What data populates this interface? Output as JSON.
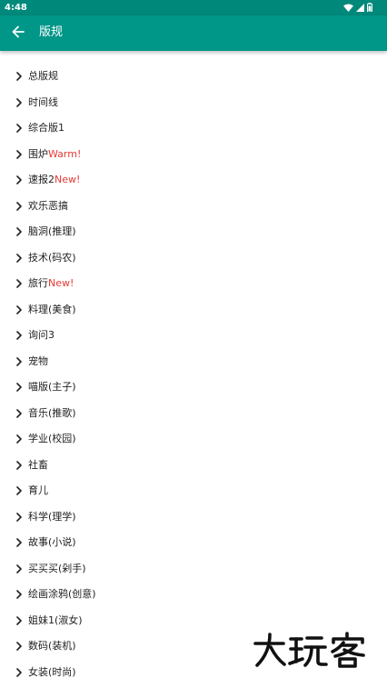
{
  "status_bar": {
    "time": "4:48",
    "icons": [
      "wifi-icon",
      "signal-icon",
      "battery-icon"
    ]
  },
  "app_bar": {
    "title": "版规",
    "back_icon": "arrow-left-icon",
    "background": "#009688"
  },
  "forums": [
    {
      "label": "总版规",
      "badge": ""
    },
    {
      "label": "时间线",
      "badge": ""
    },
    {
      "label": "综合版1",
      "badge": ""
    },
    {
      "label": "围炉",
      "badge": "Warm!"
    },
    {
      "label": "速报2",
      "badge": "New!"
    },
    {
      "label": "欢乐恶搞",
      "badge": ""
    },
    {
      "label": "脑洞(推理)",
      "badge": ""
    },
    {
      "label": "技术(码农)",
      "badge": ""
    },
    {
      "label": "旅行",
      "badge": "New!"
    },
    {
      "label": "料理(美食)",
      "badge": ""
    },
    {
      "label": "询问3",
      "badge": ""
    },
    {
      "label": "宠物",
      "badge": ""
    },
    {
      "label": "喵版(主子)",
      "badge": ""
    },
    {
      "label": "音乐(推歌)",
      "badge": ""
    },
    {
      "label": "学业(校园)",
      "badge": ""
    },
    {
      "label": "社畜",
      "badge": ""
    },
    {
      "label": "育儿",
      "badge": ""
    },
    {
      "label": "科学(理学)",
      "badge": ""
    },
    {
      "label": "故事(小说)",
      "badge": ""
    },
    {
      "label": "买买买(剁手)",
      "badge": ""
    },
    {
      "label": "绘画涂鸦(创意)",
      "badge": ""
    },
    {
      "label": "姐妹1(淑女)",
      "badge": ""
    },
    {
      "label": "数码(装机)",
      "badge": ""
    },
    {
      "label": "女装(时尚)",
      "badge": ""
    }
  ],
  "colors": {
    "badge": "#e53935",
    "status_bar": "#00897b"
  },
  "watermark": {
    "text": "大玩客"
  }
}
